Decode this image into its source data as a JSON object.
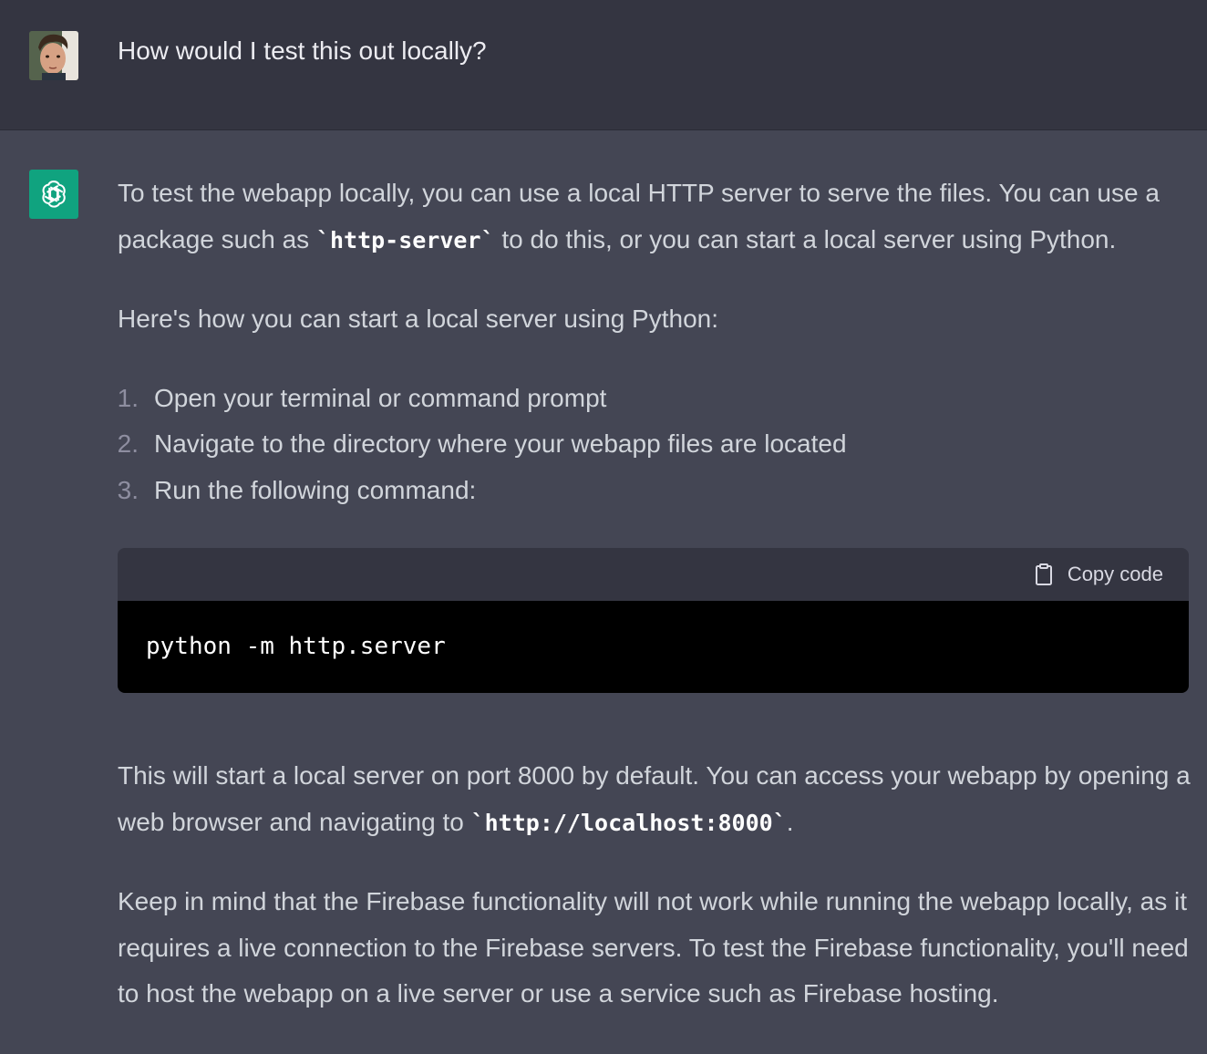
{
  "user": {
    "message": "How would I test this out locally?"
  },
  "assistant": {
    "p1": {
      "before": "To test the webapp locally, you can use a local HTTP server to serve the files. You can use a package such as ",
      "code": "`http-server`",
      "after": " to do this, or you can start a local server using Python."
    },
    "p2": "Here's how you can start a local server using Python:",
    "steps": [
      {
        "num": "1.",
        "text": "Open your terminal or command prompt"
      },
      {
        "num": "2.",
        "text": "Navigate to the directory where your webapp files are located"
      },
      {
        "num": "3.",
        "text": "Run the following command:"
      }
    ],
    "codeblock": {
      "copy_label": "Copy code",
      "code": "python -m http.server"
    },
    "p3": {
      "before": "This will start a local server on port 8000 by default. You can access your webapp by opening a web browser and navigating to ",
      "code": "`http://localhost:8000`",
      "after": "."
    },
    "p4": "Keep in mind that the Firebase functionality will not work while running the webapp locally, as it requires a live connection to the Firebase servers. To test the Firebase functionality, you'll need to host the webapp on a live server or use a service such as Firebase hosting."
  },
  "colors": {
    "user_bg": "#343541",
    "assistant_bg": "#444654",
    "gpt_accent": "#10a37f",
    "code_bg": "#000000"
  },
  "icons": {
    "user_avatar": "user-avatar",
    "assistant_avatar": "openai-logo-icon",
    "copy": "clipboard-icon"
  }
}
